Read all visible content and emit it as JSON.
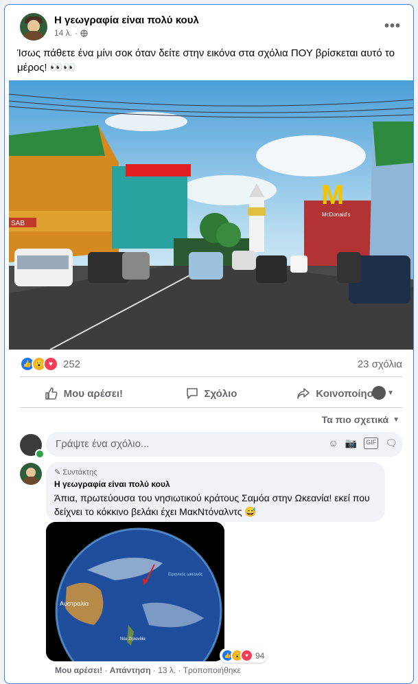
{
  "post": {
    "page_name": "Η γεωγραφία είναι πολύ κουλ",
    "time": "14 λ.",
    "text": "Ίσως πάθετε ένα μίνι σοκ όταν δείτε στην εικόνα στα σχόλια ΠΟΥ βρίσκεται αυτό το μέρος! 👀👀",
    "reaction_count": "252",
    "comments_count": "23 σχόλια"
  },
  "actions": {
    "like": "Μου αρέσει!",
    "comment": "Σχόλιο",
    "share": "Κοινοποίηση"
  },
  "comments_section": {
    "sort_label": "Τα πιο σχετικά",
    "input_placeholder": "Γράψτε ένα σχόλιο..."
  },
  "comment": {
    "badge": "Συντάκτης",
    "author": "Η γεωγραφία είναι πολύ κουλ",
    "text": "Άπια, πρωτεύουσα του νησιωτικού κράτους Σαμόα στην Ωκεανία! εκεί που δείχνει το κόκκινο βελάκι έχει ΜακΝτόναλντς 😅",
    "image_labels": {
      "australia": "Αυστραλία",
      "new_zealand": "Νέα Ζηλανδία",
      "pacific": "Ειρηνικός ωκεανός"
    },
    "reaction_count": "94",
    "like": "Μου αρέσει!",
    "reply": "Απάντηση",
    "time": "13 λ.",
    "edited": "Τροποποιήθηκε"
  },
  "photo": {
    "sign": "SAB",
    "mcdonalds": "McDonald's"
  }
}
